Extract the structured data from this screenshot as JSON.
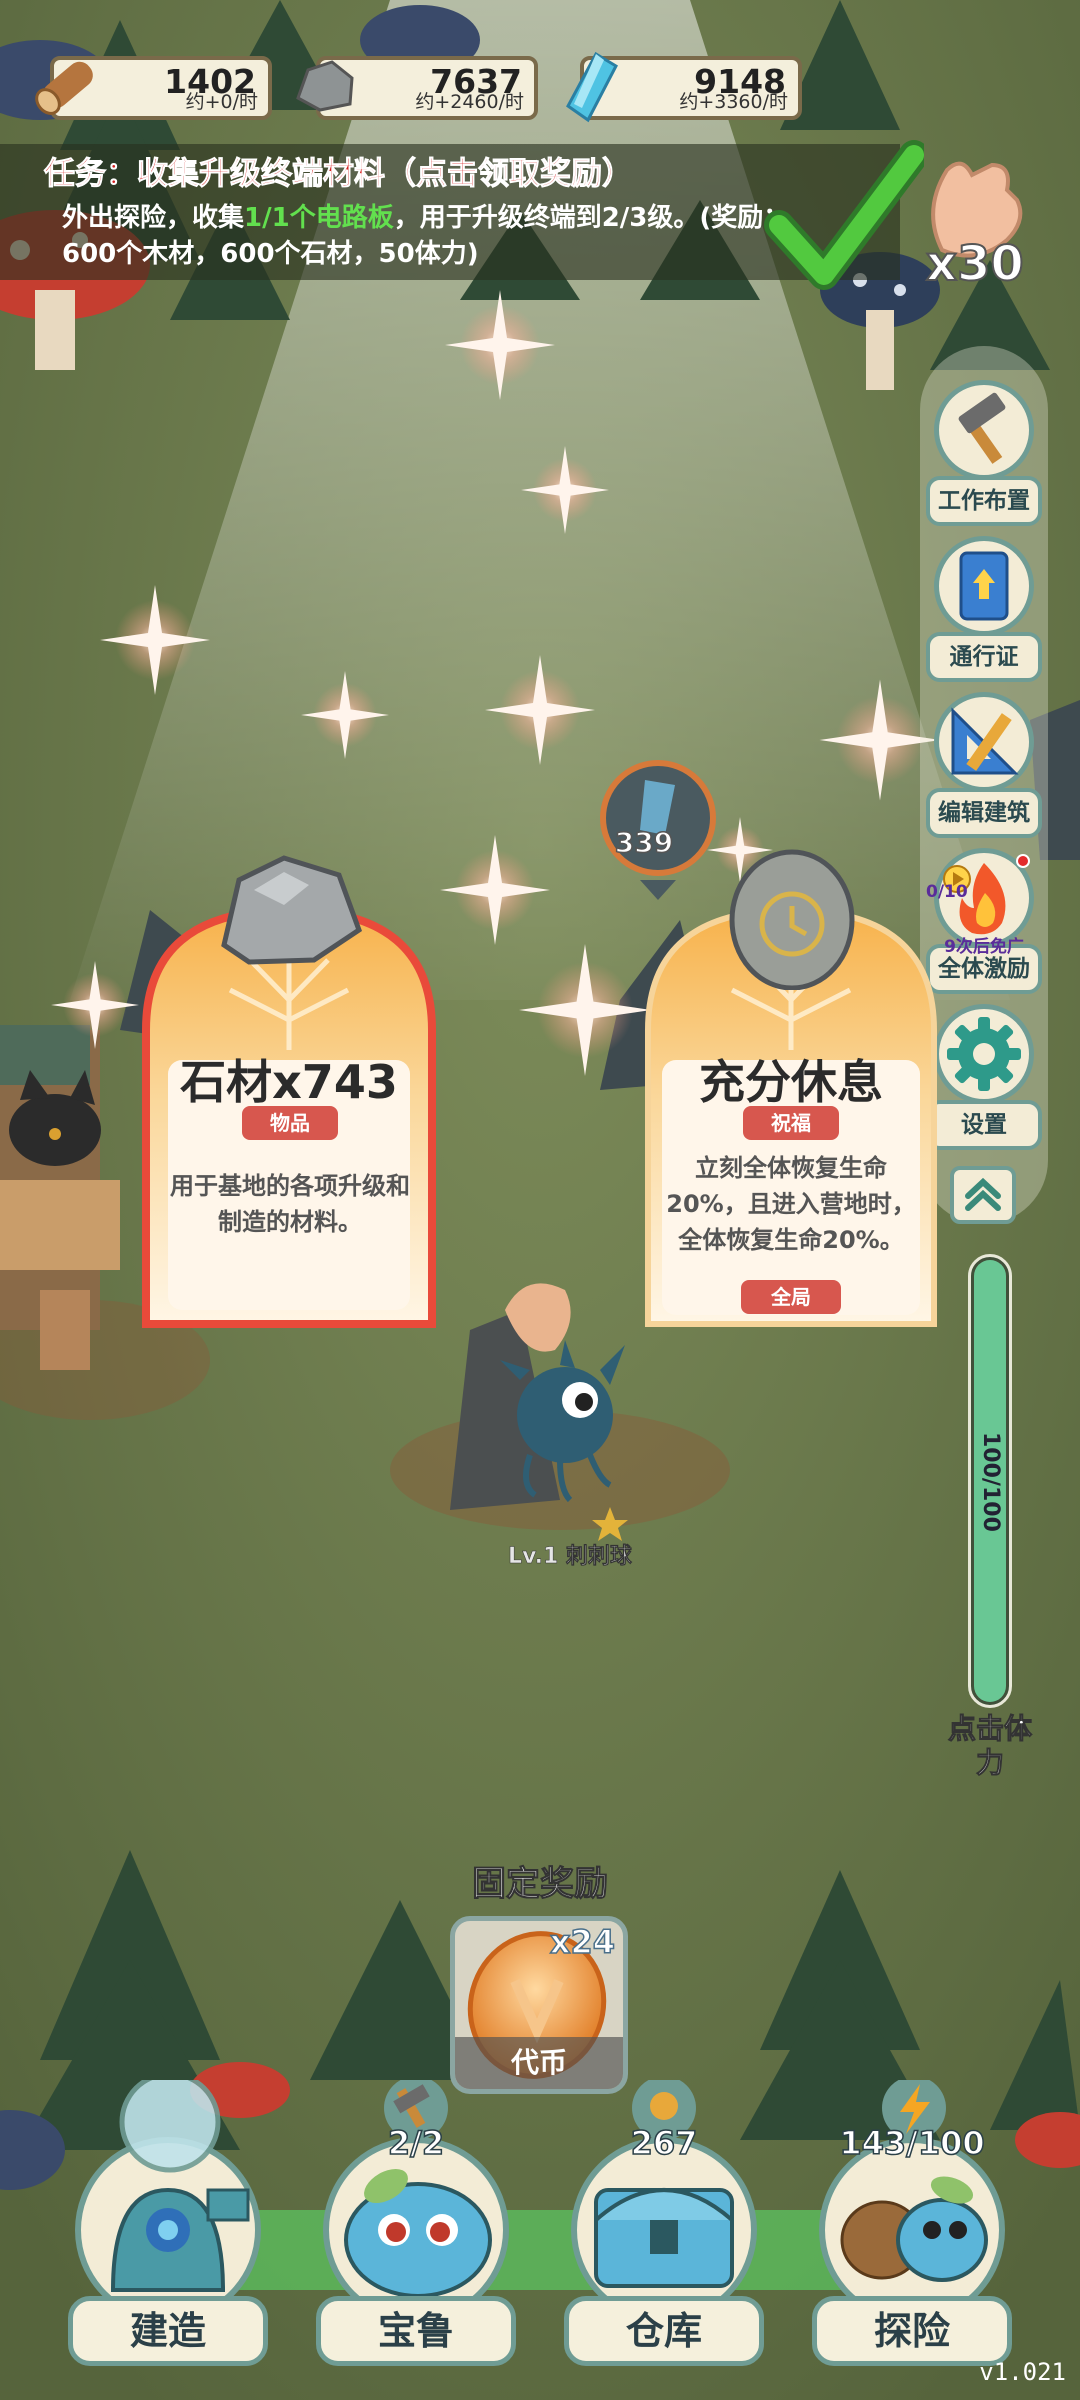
{
  "resources": [
    {
      "name": "wood",
      "amount": "1402",
      "rate": "约+0/时",
      "icon": "wood-log-icon"
    },
    {
      "name": "stone",
      "amount": "7637",
      "rate": "约+2460/时",
      "icon": "stone-icon"
    },
    {
      "name": "crystal",
      "amount": "9148",
      "rate": "约+3360/时",
      "icon": "crystal-icon"
    }
  ],
  "quest": {
    "title": "任务：收集升级终端材料（点击领取奖励）",
    "desc_pre": "外出探险，收集",
    "desc_progress": "1/1个电路板",
    "desc_post": "，用于升级终端到2/3级。(奖励：600个木材，600个石材，50体力)"
  },
  "clap": {
    "count": "x30"
  },
  "sidebar": {
    "work_layout": "工作布置",
    "pass": "通行证",
    "edit_building": "编辑建筑",
    "fire_count": "0/10",
    "fire_note": "9次后免广",
    "boost_all": "全体激励",
    "settings": "设置"
  },
  "cards": [
    {
      "title": "石材x743",
      "tag": "物品",
      "desc": "用于基地的各项升级和制造的材料。"
    },
    {
      "title": "充分休息",
      "tag": "祝福",
      "desc": "立刻全体恢复生命20%，且进入营地时，全体恢复生命20%。",
      "footer": "全局"
    }
  ],
  "enemy": {
    "hp": "339"
  },
  "unit": {
    "label": "Lv.1 刺刺球"
  },
  "stamina": {
    "value": "100/100",
    "fraction": 1.0,
    "label": "点击体力"
  },
  "fixed_reward": {
    "label": "固定奖励",
    "mult": "x24",
    "name": "代币"
  },
  "bottom_nav": [
    {
      "label": "建造",
      "count": ""
    },
    {
      "label": "宝鲁",
      "count": "2/2"
    },
    {
      "label": "仓库",
      "count": "267"
    },
    {
      "label": "探险",
      "count": "143/100"
    }
  ],
  "version": "v1.021",
  "colors": {
    "quest_title": "#d41f1f",
    "quest_progress": "#62e04e",
    "stamina": "#69c794",
    "tag": "#d7574e",
    "card_border": "#e94a3a",
    "card_glow": "#f0a63a"
  }
}
